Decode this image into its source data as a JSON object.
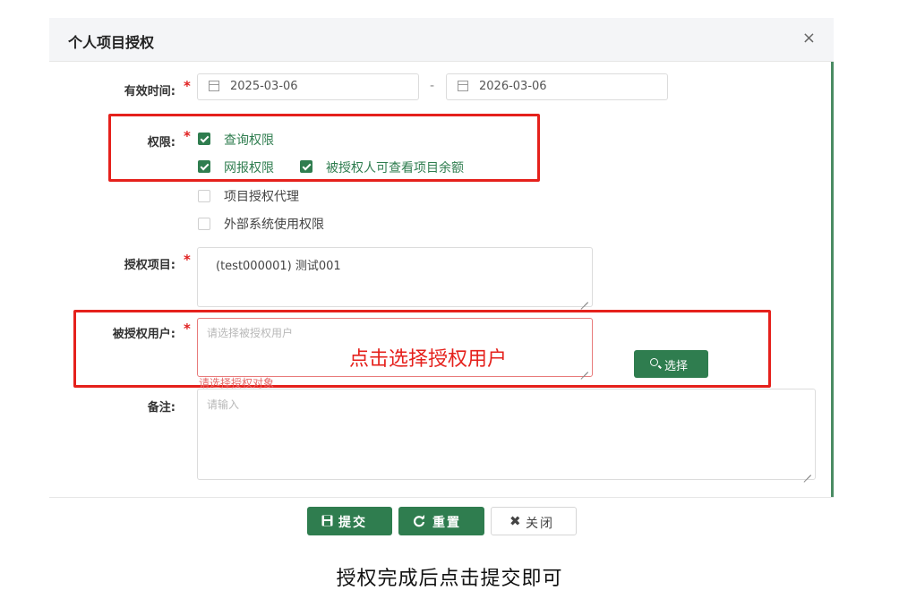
{
  "dialog": {
    "title": "个人项目授权",
    "close_icon": "×"
  },
  "form": {
    "valid_time": {
      "label": "有效时间:",
      "required": "*",
      "start": "2025-03-06",
      "separator": "-",
      "end": "2026-03-06"
    },
    "permission": {
      "label": "权限:",
      "required": "*",
      "options": [
        {
          "label": "查询权限",
          "checked": true
        },
        {
          "label": "网报权限",
          "checked": true
        },
        {
          "label": "被授权人可查看项目余额",
          "checked": true
        },
        {
          "label": "项目授权代理",
          "checked": false
        },
        {
          "label": "外部系统使用权限",
          "checked": false
        }
      ]
    },
    "project": {
      "label": "授权项目:",
      "required": "*",
      "value": "(test000001) 测试001"
    },
    "user": {
      "label": "被授权用户:",
      "required": "*",
      "placeholder": "请选择被授权用户",
      "annotation": "点击选择授权用户",
      "error": "请选择授权对象",
      "select_button": "选择"
    },
    "remark": {
      "label": "备注:",
      "placeholder": "请输入"
    }
  },
  "footer": {
    "submit": "提交",
    "reset": "重置",
    "close": "关闭"
  },
  "caption": "授权完成后点击提交即可",
  "colors": {
    "accent": "#2f7d4f",
    "annotation": "#e5211c",
    "required": "#e02020"
  }
}
